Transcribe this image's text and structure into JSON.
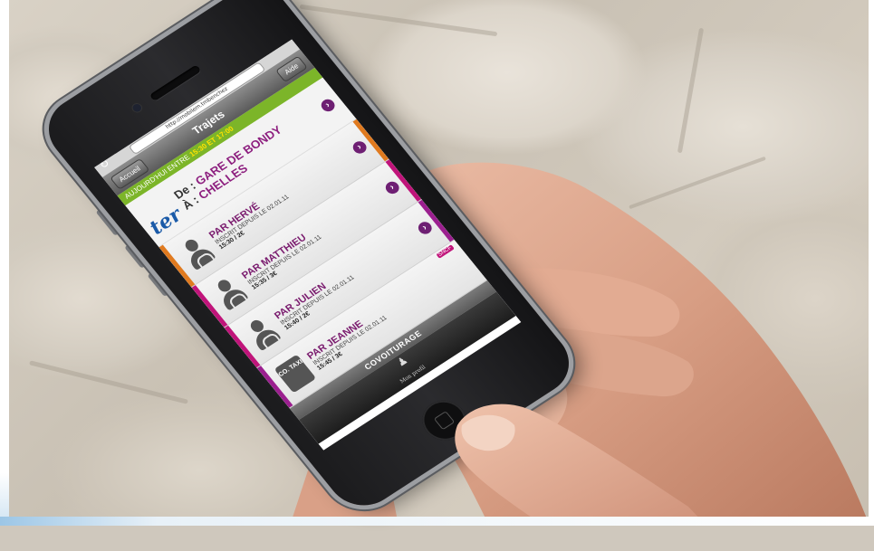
{
  "browser": {
    "url": "http://mobilem.tmbenchez",
    "back_label": "Accueil",
    "help_label": "Aide",
    "title": "Trajets"
  },
  "info": {
    "prefix": "AUJOURD'HUI ENTRE",
    "time_range": "15:30 ET 17:00"
  },
  "route": {
    "from_prefix": "De :",
    "from": "GARE DE BONDY",
    "to_prefix": "À :",
    "to": "CHELLES",
    "logo_text": "ter"
  },
  "rides": [
    {
      "name": "PAR HERVÉ",
      "since": "INSCRIT DEPUIS LE 02.01.11",
      "time_price": "15:30 / 2€",
      "stripe": "#e07a1f",
      "icon": "person-icon"
    },
    {
      "name": "PAR MATTHIEU",
      "since": "INSCRIT DEPUIS LE 02.01.11",
      "time_price": "15:35 / 3€",
      "stripe": "#c0147a",
      "icon": "person-icon"
    },
    {
      "name": "PAR JULIEN",
      "since": "INSCRIT DEPUIS LE 02.01.11",
      "time_price": "15:40 / 2€",
      "stripe": "#c0147a",
      "icon": "person-icon"
    },
    {
      "name": "PAR JEANNE",
      "since": "INSCRIT DEPUIS LE 02.01.11",
      "time_price": "15:45 / 3€",
      "stripe": "#9b1f8f",
      "icon": "taxi-icon"
    }
  ],
  "taxi_label": "CO. TAXI",
  "badge": "SNCF",
  "bottom_bar": {
    "label": "COVOITURAGE"
  },
  "tab": {
    "label": "Mon profil",
    "icon": "profile-icon"
  },
  "colors": {
    "accent_green": "#7cb529",
    "accent_purple": "#7a1b6e",
    "time_highlight": "#ffe300"
  }
}
